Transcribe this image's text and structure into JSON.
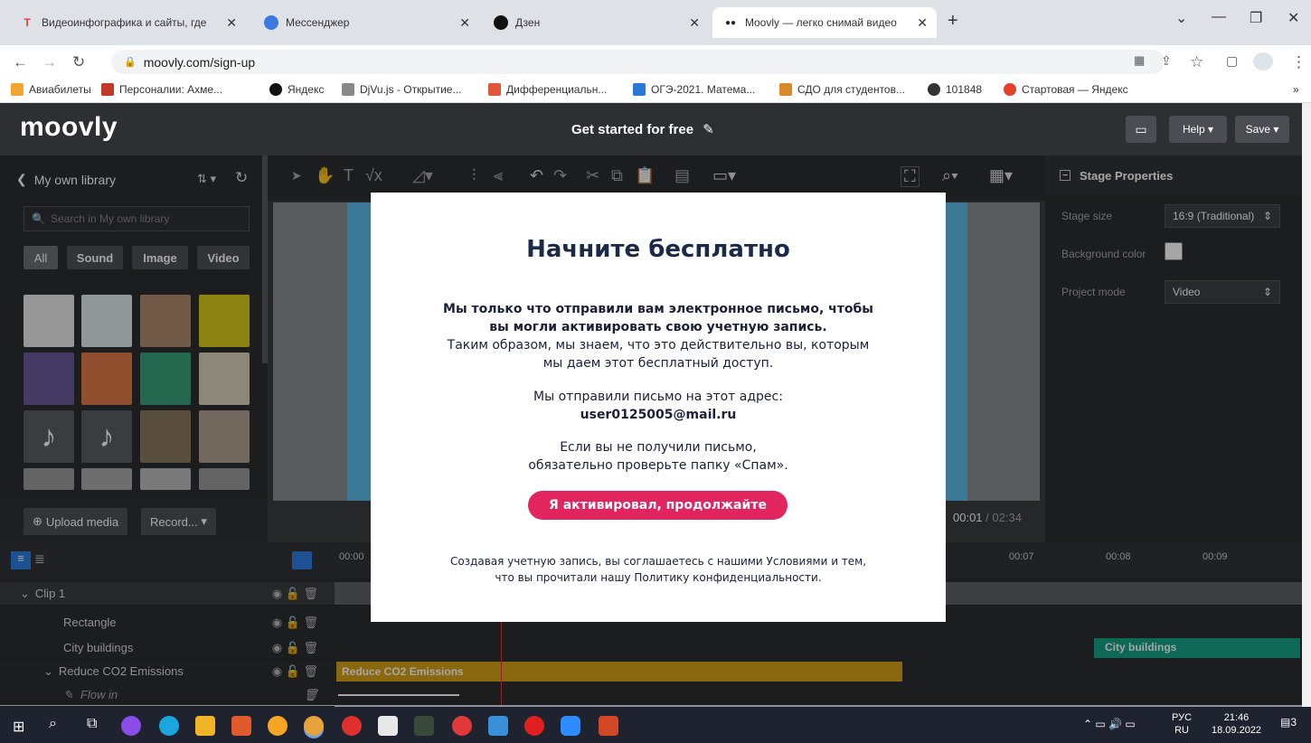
{
  "browser": {
    "tabs": [
      {
        "title": "Видеоинфографика и сайты, где",
        "favicon": "T",
        "favicon_color": "#e0413e"
      },
      {
        "title": "Мессенджер",
        "favicon": "",
        "favicon_color": "#3c7ae0"
      },
      {
        "title": "Дзен",
        "favicon": "",
        "favicon_color": "#111111"
      },
      {
        "title": "Moovly — легко снимай видео",
        "favicon": "●●",
        "favicon_color": "#23263a"
      }
    ],
    "new_tab": "+",
    "url": "moovly.com/sign-up",
    "bookmarks": [
      {
        "label": "Авиабилеты",
        "color": "#f2a52f"
      },
      {
        "label": "Персоналии: Ахме...",
        "color": "#c0392b"
      },
      {
        "label": "Яндекс",
        "color": "#111111"
      },
      {
        "label": "DjVu.js - Открытие...",
        "color": "#888888"
      },
      {
        "label": "Дифференциальн...",
        "color": "#e0553e"
      },
      {
        "label": "ОГЭ-2021. Матема...",
        "color": "#2c78d6"
      },
      {
        "label": "СДО для студентов...",
        "color": "#d98b2b"
      },
      {
        "label": "101848",
        "color": "#333333"
      },
      {
        "label": "Стартовая — Яндекс",
        "color": "#e3412b"
      }
    ],
    "bookmarks_more": "»"
  },
  "app": {
    "logo": "moovly",
    "title": "Get started for free",
    "help_label": "Help",
    "save_label": "Save"
  },
  "library": {
    "title": "My own library",
    "search_placeholder": "Search in My own library",
    "filters": [
      "All",
      "Sound",
      "Image",
      "Video"
    ],
    "upload_label": "Upload media",
    "record_label": "Record..."
  },
  "editor": {
    "time_current": "00:01",
    "time_total": "02:34"
  },
  "properties": {
    "title": "Stage Properties",
    "stage_size_label": "Stage size",
    "stage_size_value": "16:9 (Traditional)",
    "bg_color_label": "Background color",
    "project_mode_label": "Project mode",
    "project_mode_value": "Video"
  },
  "timeline": {
    "ticks": [
      "00:00",
      "00:07",
      "00:08",
      "00:09"
    ],
    "rows": [
      {
        "label": "Clip 1"
      },
      {
        "label": "Rectangle"
      },
      {
        "label": "City buildings"
      },
      {
        "label": "Reduce CO2 Emissions"
      },
      {
        "label": "Flow in"
      }
    ],
    "bar_city": "City buildings",
    "bar_co2": "Reduce CO2 Emissions"
  },
  "modal": {
    "title": "Начните бесплатно",
    "bold_line1": "Мы только что отправили вам электронное письмо, чтобы",
    "bold_line2": "вы могли активировать свою учетную запись.",
    "line3": "Таким образом, мы знаем, что это действительно вы, которым",
    "line4": "мы даем этот бесплатный доступ.",
    "sent_to": "Мы отправили письмо на этот адрес:",
    "email": "user0125005@mail.ru",
    "spam1": "Если вы не получили письмо,",
    "spam2": "обязательно проверьте папку «Спам».",
    "button": "Я активировал, продолжайте",
    "terms1": "Создавая учетную запись, вы соглашаетесь с нашими Условиями и тем,",
    "terms2": "что вы прочитали нашу Политику конфиденциальности."
  },
  "taskbar": {
    "lang_top": "РУС",
    "lang_bottom": "RU",
    "time": "21:46",
    "date": "18.09.2022",
    "notif": "3"
  }
}
